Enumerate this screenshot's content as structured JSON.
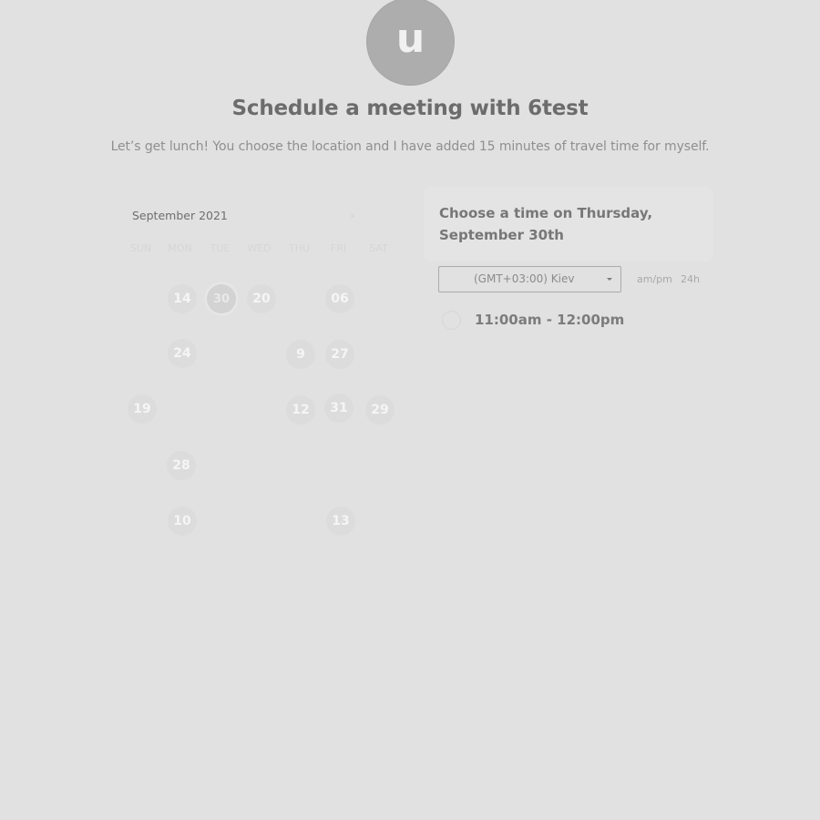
{
  "header": {
    "avatar_letter": "u",
    "title": "Schedule a meeting with 6test",
    "subtitle": "Let’s get lunch! You choose the location and I have added 15 minutes of travel time for myself."
  },
  "calendar": {
    "month": "September 2021",
    "next_icon": "chevron-right-icon",
    "next_glyph": "›",
    "weekdays": [
      "SUN",
      "MON",
      "TUE",
      "WED",
      "THU",
      "FRI",
      "SAT"
    ],
    "days": [
      {
        "label": "14"
      },
      {
        "label": "20"
      },
      {
        "label": "06"
      },
      {
        "label": "24"
      },
      {
        "label": "9"
      },
      {
        "label": "27"
      },
      {
        "label": "19"
      },
      {
        "label": "12"
      },
      {
        "label": "31"
      },
      {
        "label": "29"
      },
      {
        "label": "28"
      },
      {
        "label": "10"
      },
      {
        "label": "13"
      },
      {
        "label": "30"
      }
    ]
  },
  "panel": {
    "choose_text": "Choose a time on Thursday, September 30th",
    "timezone": "(GMT+03:00) Kiev",
    "format_12": "am/pm",
    "format_24": "24h",
    "slots": [
      {
        "label": "11:00am - 12:00pm"
      }
    ]
  },
  "colors": {
    "background": "#e1e1e1",
    "avatar": "#adadad",
    "title": "#6c6c6c"
  }
}
